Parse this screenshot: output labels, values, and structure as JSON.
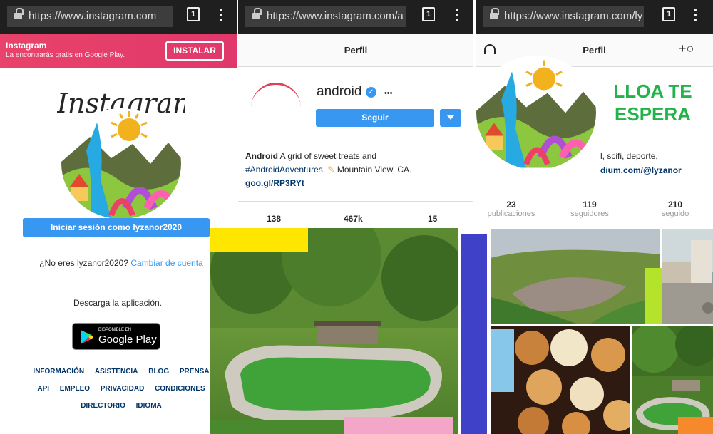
{
  "panel1": {
    "url": "https://www.instagram.com",
    "tab_count": "1",
    "banner": {
      "title": "Instagram",
      "subtitle": "La encontrarás gratis en Google Play.",
      "install_label": "INSTALAR"
    },
    "wordmark": "Instagram",
    "login_button": "Iniciar sesión como lyzanor2020",
    "not_you": "¿No eres lyzanor2020?",
    "switch_account": "Cambiar de cuenta",
    "download_text": "Descarga la aplicación.",
    "store_small": "DISPONIBLE EN",
    "store_big": "Google Play",
    "footer_row1": [
      "INFORMACIÓN",
      "ASISTENCIA",
      "BLOG",
      "PRENSA"
    ],
    "footer_row2": [
      "API",
      "EMPLEO",
      "PRIVACIDAD",
      "CONDICIONES"
    ],
    "footer_row3": [
      "DIRECTORIO",
      "IDIOMA"
    ]
  },
  "panel2": {
    "url": "https://www.instagram.com/a",
    "tab_count": "1",
    "header_title": "Perfil",
    "username": "android",
    "more": "•••",
    "follow_label": "Seguir",
    "bio_name": "Android",
    "bio_text": "A grid of sweet treats and",
    "bio_hashtag": "#AndroidAdventures.",
    "bio_location": "Mountain View, CA.",
    "bio_link": "goo.gl/RP3RYt",
    "stats": [
      "138",
      "467k",
      "15"
    ]
  },
  "panel3": {
    "url": "https://www.instagram.com/ly",
    "tab_count": "1",
    "header_title": "Perfil",
    "promo_line1": "LLOA TE",
    "promo_line2": "ESPERA",
    "bio_fragment": "l, scifi, deporte,",
    "bio_link": "dium.com/@lyzanor",
    "stats": [
      {
        "value": "23",
        "label": "publicaciones"
      },
      {
        "value": "119",
        "label": "seguidores"
      },
      {
        "value": "210",
        "label": "seguido"
      }
    ]
  },
  "colors": {
    "instagram_blue": "#3897f0",
    "banner_pink": "#e8436a",
    "promo_green": "#22b34a"
  }
}
